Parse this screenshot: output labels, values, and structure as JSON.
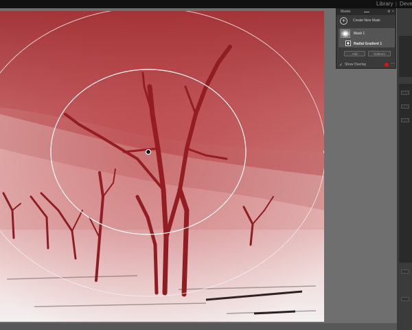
{
  "topbar": {
    "modules": [
      "Library",
      "Develop"
    ]
  },
  "masks_panel": {
    "title": "Masks",
    "create_label": "Create New Mask",
    "mask_name": "Mask 1",
    "component_name": "Radial Gradient 1",
    "add_label": "Add",
    "subtract_label": "Subtract",
    "overlay_label": "Show Overlay",
    "overlay_color": "#d11a1a"
  },
  "photo": {
    "mask_overlay_color": "#c02828",
    "icons": [
      "mask-pin-icon"
    ]
  }
}
